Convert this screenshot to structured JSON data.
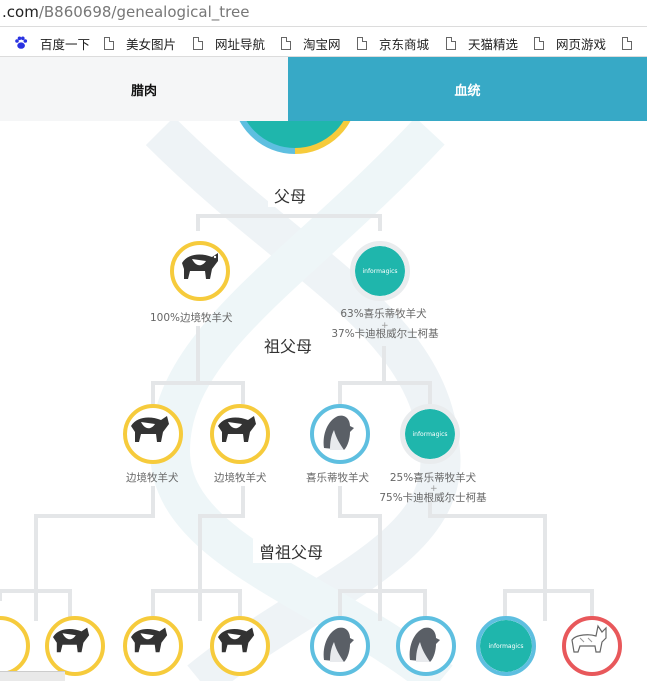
{
  "url": {
    "host": ".com",
    "path": "/B860698/genealogical_tree"
  },
  "bookmarks": [
    {
      "label": "百度一下",
      "icon": "baidu-paw-icon"
    },
    {
      "label": "美女图片",
      "icon": "page-icon"
    },
    {
      "label": "网址导航",
      "icon": "page-icon"
    },
    {
      "label": "淘宝网",
      "icon": "page-icon"
    },
    {
      "label": "京东商城",
      "icon": "page-icon"
    },
    {
      "label": "天猫精选",
      "icon": "page-icon"
    },
    {
      "label": "网页游戏",
      "icon": "page-icon"
    }
  ],
  "tabs": {
    "left": "腊肉",
    "right": "血统"
  },
  "generations": {
    "parents": "父母",
    "grandparents": "祖父母",
    "great_grandparents": "曾祖父母"
  },
  "parents": [
    {
      "label": "100%边境牧羊犬",
      "ring": "yellow",
      "dog": "border-collie"
    },
    {
      "label_line1": "63%喜乐蒂牧羊犬",
      "plus": "+",
      "label_line2": "37%卡迪根威尔士柯基",
      "ring": "grey",
      "dog": "informagics-logo"
    }
  ],
  "grandparents": [
    {
      "label": "边境牧羊犬",
      "ring": "yellow",
      "dog": "border-collie"
    },
    {
      "label": "边境牧羊犬",
      "ring": "yellow",
      "dog": "border-collie"
    },
    {
      "label": "喜乐蒂牧羊犬",
      "ring": "blue",
      "dog": "sheltie"
    },
    {
      "label_line1": "25%喜乐蒂牧羊犬",
      "plus": "+",
      "label_line2": "75%卡迪根威尔士柯基",
      "ring": "grey",
      "dog": "informagics-logo"
    }
  ],
  "great_grandparents": [
    {
      "ring": "yellow",
      "dog": "border-collie"
    },
    {
      "ring": "yellow",
      "dog": "border-collie"
    },
    {
      "ring": "yellow",
      "dog": "border-collie"
    },
    {
      "ring": "yellow",
      "dog": "border-collie"
    },
    {
      "ring": "blue",
      "dog": "sheltie"
    },
    {
      "ring": "blue",
      "dog": "sheltie"
    },
    {
      "ring": "blue",
      "dog": "informagics-logo"
    },
    {
      "ring": "red",
      "dog": "corgi"
    }
  ],
  "logo_text": "informagics",
  "colors": {
    "accent_tab": "#37a9c6",
    "yellow": "#f6cb3c",
    "blue": "#5ebfe0",
    "red": "#e8585b",
    "teal": "#1fb6ac"
  }
}
